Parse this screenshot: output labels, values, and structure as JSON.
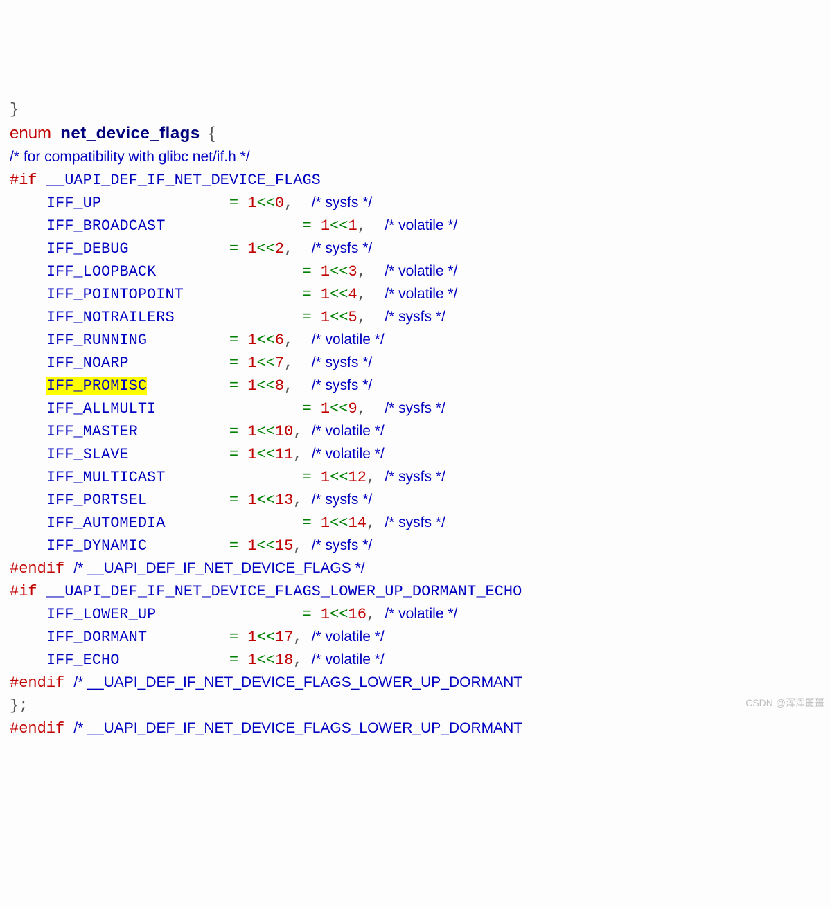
{
  "header": {
    "dangling_close": "}",
    "enum_kw": "enum",
    "enum_name": "net_device_flags",
    "open_brace": "{",
    "compat_comment": "/* for compatibility with glibc net/if.h */"
  },
  "block1": {
    "if_kw": "#if",
    "if_cond": "__UAPI_DEF_IF_NET_DEVICE_FLAGS",
    "endif_kw": "#endif",
    "endif_cm": "/* __UAPI_DEF_IF_NET_DEVICE_FLAGS */",
    "rows": [
      {
        "name": "IFF_UP",
        "digit1": "1",
        "shift": "0",
        "eq_col": 24,
        "cm": "/* sysfs */",
        "hl": false
      },
      {
        "name": "IFF_BROADCAST",
        "digit1": "1",
        "shift": "1",
        "eq_col": 32,
        "cm": "/* volatile */",
        "hl": false
      },
      {
        "name": "IFF_DEBUG",
        "digit1": "1",
        "shift": "2",
        "eq_col": 24,
        "cm": "/* sysfs */",
        "hl": false
      },
      {
        "name": "IFF_LOOPBACK",
        "digit1": "1",
        "shift": "3",
        "eq_col": 32,
        "cm": "/* volatile */",
        "hl": false
      },
      {
        "name": "IFF_POINTOPOINT",
        "digit1": "1",
        "shift": "4",
        "eq_col": 32,
        "cm": "/* volatile */",
        "hl": false
      },
      {
        "name": "IFF_NOTRAILERS",
        "digit1": "1",
        "shift": "5",
        "eq_col": 32,
        "cm": "/* sysfs */",
        "hl": false
      },
      {
        "name": "IFF_RUNNING",
        "digit1": "1",
        "shift": "6",
        "eq_col": 24,
        "cm": "/* volatile */",
        "hl": false
      },
      {
        "name": "IFF_NOARP",
        "digit1": "1",
        "shift": "7",
        "eq_col": 24,
        "cm": "/* sysfs */",
        "hl": false
      },
      {
        "name": "IFF_PROMISC",
        "digit1": "1",
        "shift": "8",
        "eq_col": 24,
        "cm": "/* sysfs */",
        "hl": true
      },
      {
        "name": "IFF_ALLMULTI",
        "digit1": "1",
        "shift": "9",
        "eq_col": 32,
        "cm": "/* sysfs */",
        "hl": false
      },
      {
        "name": "IFF_MASTER",
        "digit1": "1",
        "shift": "10",
        "eq_col": 24,
        "cm": "/* volatile */",
        "hl": false
      },
      {
        "name": "IFF_SLAVE",
        "digit1": "1",
        "shift": "11",
        "eq_col": 24,
        "cm": "/* volatile */",
        "hl": false
      },
      {
        "name": "IFF_MULTICAST",
        "digit1": "1",
        "shift": "12",
        "eq_col": 32,
        "cm": "/* sysfs */",
        "hl": false
      },
      {
        "name": "IFF_PORTSEL",
        "digit1": "1",
        "shift": "13",
        "eq_col": 24,
        "cm": "/* sysfs */",
        "hl": false
      },
      {
        "name": "IFF_AUTOMEDIA",
        "digit1": "1",
        "shift": "14",
        "eq_col": 32,
        "cm": "/* sysfs */",
        "hl": false
      },
      {
        "name": "IFF_DYNAMIC",
        "digit1": "1",
        "shift": "15",
        "eq_col": 24,
        "cm": "/* sysfs */",
        "hl": false
      }
    ]
  },
  "block2": {
    "if_kw": "#if",
    "if_cond": "__UAPI_DEF_IF_NET_DEVICE_FLAGS_LOWER_UP_DORMANT_ECHO",
    "endif_kw": "#endif",
    "endif_cm": "/* __UAPI_DEF_IF_NET_DEVICE_FLAGS_LOWER_UP_DORMANT",
    "rows": [
      {
        "name": "IFF_LOWER_UP",
        "digit1": "1",
        "shift": "16",
        "eq_col": 32,
        "cm": "/* volatile */",
        "hl": false
      },
      {
        "name": "IFF_DORMANT",
        "digit1": "1",
        "shift": "17",
        "eq_col": 24,
        "cm": "/* volatile */",
        "hl": false
      },
      {
        "name": "IFF_ECHO",
        "digit1": "1",
        "shift": "18",
        "eq_col": 24,
        "cm": "/* volatile */",
        "hl": false
      }
    ]
  },
  "trailer": {
    "close_brace": "};",
    "endif_kw": "#endif",
    "endif_cm": "/* __UAPI_DEF_IF_NET_DEVICE_FLAGS_LOWER_UP_DORMANT"
  },
  "watermark": "CSDN @浑浑噩噩"
}
